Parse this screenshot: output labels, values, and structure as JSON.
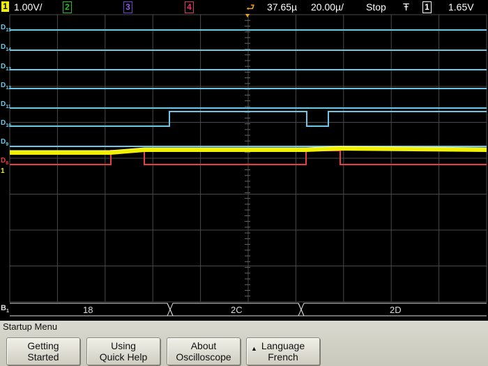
{
  "status": {
    "ch1_number": "1",
    "ch1_scale": "1.00V/",
    "ch2_number": "2",
    "ch3_number": "3",
    "ch4_number": "4",
    "time_delay": "37.65µ",
    "time_scale": "20.00µ/",
    "run_state": "Stop",
    "trigger_source": "1",
    "trigger_level": "1.65V"
  },
  "digital_labels": [
    {
      "base": "D",
      "sub": "15"
    },
    {
      "base": "D",
      "sub": "14"
    },
    {
      "base": "D",
      "sub": "13"
    },
    {
      "base": "D",
      "sub": "12"
    },
    {
      "base": "D",
      "sub": "11"
    },
    {
      "base": "D",
      "sub": "10"
    },
    {
      "base": "D",
      "sub": "9"
    },
    {
      "base": "D",
      "sub": "8"
    }
  ],
  "analog_marker": "1",
  "bus": {
    "label_base": "B",
    "label_sub": "1",
    "values": [
      "18",
      "2C",
      "2D"
    ]
  },
  "menu": {
    "title": "Startup Menu",
    "softkeys": [
      {
        "line1": "Getting",
        "line2": "Started"
      },
      {
        "line1": "Using",
        "line2": "Quick Help"
      },
      {
        "line1": "About",
        "line2": "Oscilloscope"
      },
      {
        "line1": "Language",
        "line2": "French"
      }
    ]
  },
  "colors": {
    "ch1": "#f0f000",
    "ch2": "#20c020",
    "ch3": "#7040d0",
    "ch4": "#e03070",
    "digital": "#6cc8e8",
    "d8": "#e84040",
    "grid": "#4a4a4a"
  }
}
